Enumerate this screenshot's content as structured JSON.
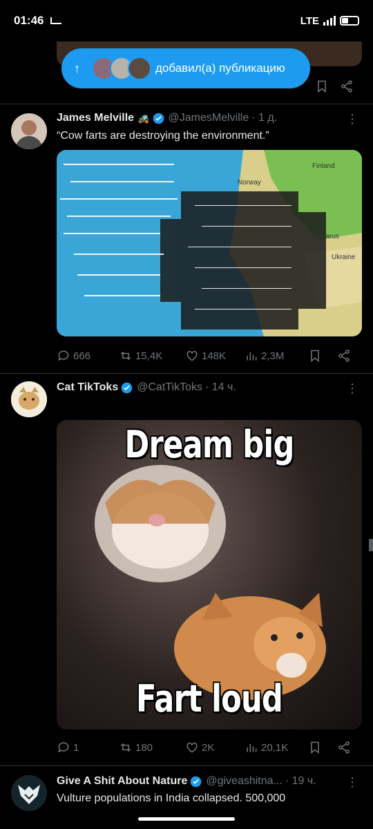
{
  "status_bar": {
    "time": "01:46",
    "network": "LTE"
  },
  "banner": {
    "text": "добавил(а) публикацию"
  },
  "tweets": [
    {
      "name": "James Melville",
      "handle": "@JamesMelville",
      "time": "· 1 д.",
      "text": "“Cow farts are destroying the environment.”",
      "map_labels": [
        "Finland",
        "Norway",
        "Belarus",
        "Ukraine"
      ],
      "stats": {
        "replies": "666",
        "retweets": "15,4K",
        "likes": "148K",
        "views": "2,3M"
      }
    },
    {
      "name": "Cat TikToks",
      "handle": "@CatTikToks",
      "time": "· 14 ч.",
      "meme_top": "Dream big",
      "meme_bottom": "Fart loud",
      "stats": {
        "replies": "1",
        "retweets": "180",
        "likes": "2K",
        "views": "20,1K"
      }
    },
    {
      "name": "Give A Shit About Nature",
      "handle": "@giveashitna...",
      "time": "· 19 ч.",
      "text": "Vulture populations in India collapsed. 500,000"
    }
  ],
  "colors": {
    "accent": "#1d9bf0",
    "muted": "#71767b",
    "divider": "#2f3336"
  },
  "icons": [
    "reply-icon",
    "retweet-icon",
    "like-icon",
    "views-icon",
    "bookmark-icon",
    "share-icon",
    "verified-icon",
    "more-icon"
  ]
}
